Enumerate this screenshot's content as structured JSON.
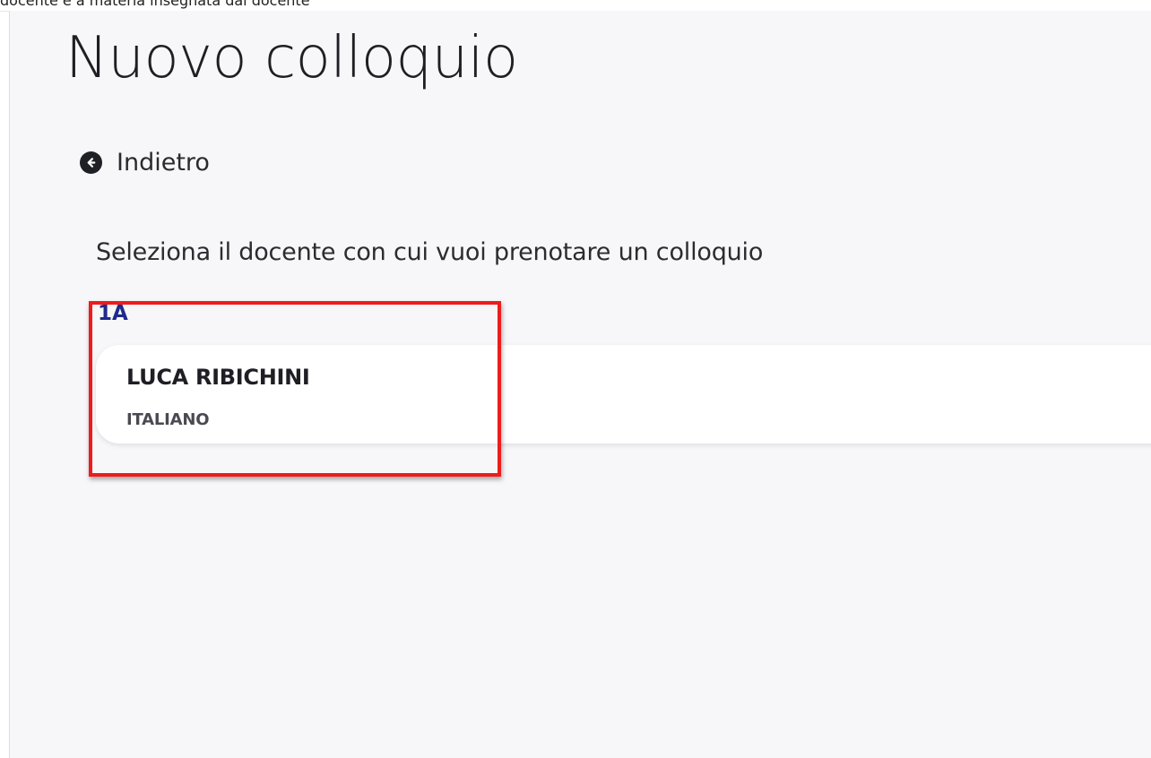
{
  "header_strip": {
    "text": "docente e a materia insegnata dal docente"
  },
  "page": {
    "title": "Nuovo colloquio",
    "back_label": "Indietro",
    "back_icon": "arrow-left-circle-icon",
    "instruction": "Seleziona il docente con cui vuoi prenotare un colloquio"
  },
  "groups": [
    {
      "class_label": "1A",
      "teachers": [
        {
          "name": "LUCA RIBICHINI",
          "subject": "ITALIANO"
        }
      ]
    }
  ],
  "colors": {
    "background": "#f7f7f9",
    "card": "#ffffff",
    "class_label": "#1f2a8c",
    "highlight": "#ee1c1c",
    "text": "#1e1e24"
  }
}
